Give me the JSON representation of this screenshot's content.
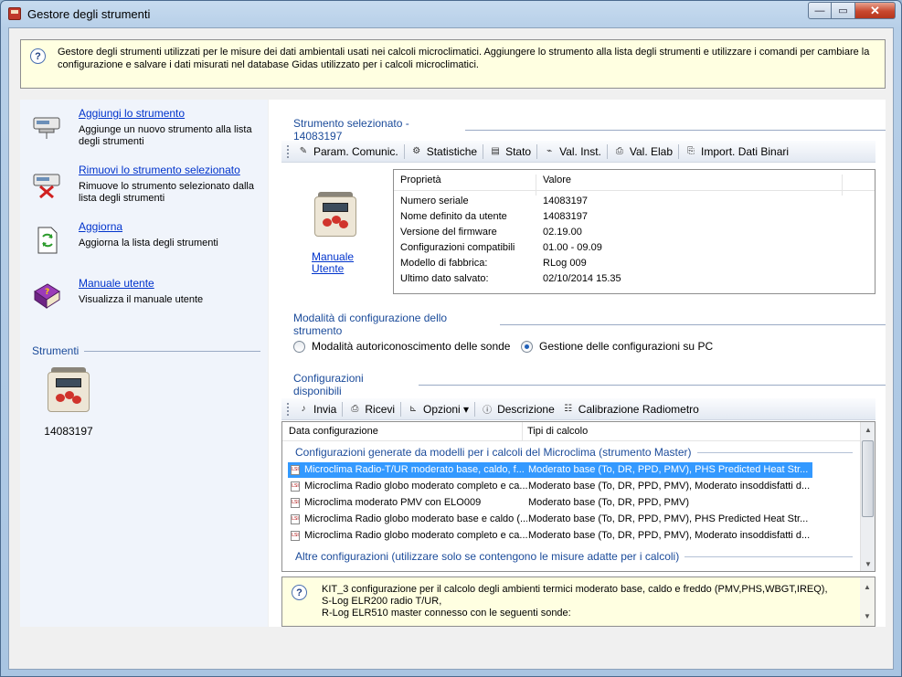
{
  "window": {
    "title": "Gestore degli strumenti",
    "minimize": "—",
    "maximize": "▭",
    "close": "✕"
  },
  "info_banner": {
    "icon": "?",
    "text": "Gestore degli strumenti utilizzati per le misure dei dati ambientali usati nei calcoli microclimatici. Aggiungere lo strumento alla lista degli strumenti e utilizzare i comandi per cambiare la configurazione e salvare i dati misurati nel database Gidas utilizzato per i calcoli microclimatici."
  },
  "sidebar": {
    "tasks": [
      {
        "label": "Aggiungi lo strumento",
        "description": "Aggiunge un nuovo strumento alla lista degli strumenti",
        "icon": "add-instrument-icon"
      },
      {
        "label": "Rimuovi lo strumento selezionato",
        "description": "Rimuove lo strumento selezionato dalla lista degli strumenti",
        "icon": "remove-instrument-icon"
      },
      {
        "label": "Aggiorna",
        "description": "Aggiorna la lista degli strumenti",
        "icon": "refresh-icon"
      },
      {
        "label": "Manuale utente",
        "description": "Visualizza il manuale utente",
        "icon": "manual-book-icon"
      }
    ],
    "instruments_header": "Strumenti",
    "instruments": [
      {
        "label": "14083197"
      }
    ]
  },
  "main": {
    "selected_header": "Strumento selezionato  - 14083197",
    "toolbar1": [
      {
        "label": "Param. Comunic.",
        "icon": "wrench-icon"
      },
      {
        "label": "Statistiche",
        "icon": "statistics-icon"
      },
      {
        "label": "Stato",
        "icon": "status-icon"
      },
      {
        "label": "Val. Inst.",
        "icon": "instant-values-icon"
      },
      {
        "label": "Val. Elab",
        "icon": "processed-values-icon"
      },
      {
        "label": "Import. Dati Binari",
        "icon": "import-binary-icon"
      }
    ],
    "manual_link": "Manuale Utente",
    "properties": {
      "col_property": "Proprietà",
      "col_value": "Valore",
      "rows": [
        {
          "name": "Numero seriale",
          "value": "14083197"
        },
        {
          "name": "Nome definito da utente",
          "value": "14083197"
        },
        {
          "name": "Versione del firmware",
          "value": "02.19.00"
        },
        {
          "name": "Configurazioni compatibili",
          "value": "01.00 - 09.09"
        },
        {
          "name": "Modello di fabbrica:",
          "value": "RLog 009"
        },
        {
          "name": "Ultimo dato salvato:",
          "value": "02/10/2014 15.35"
        }
      ]
    },
    "config_mode_header": "Modalità di configurazione dello strumento",
    "radio_auto": "Modalità autoriconoscimento delle sonde",
    "radio_pc": "Gestione delle configurazioni su PC",
    "configs_header": "Configurazioni disponibili",
    "toolbar2": [
      {
        "label": "Invia",
        "icon": "send-icon"
      },
      {
        "label": "Ricevi",
        "icon": "receive-icon"
      },
      {
        "label": "Opzioni ▾",
        "icon": "options-icon"
      },
      {
        "label": "Descrizione",
        "icon": "description-icon"
      },
      {
        "label": "Calibrazione Radiometro",
        "icon": "calibration-icon"
      }
    ],
    "config_list": {
      "col_date": "Data configurazione",
      "col_types": "Tipi di calcolo",
      "group1": "Configurazioni generate da modelli per i calcoli del Microclima  (strumento Master)",
      "rows": [
        {
          "name": "Microclima Radio-T/UR moderato base, caldo, f...",
          "types": "Moderato base (To, DR, PPD, PMV), PHS Predicted Heat Str...",
          "selected": true
        },
        {
          "name": "Microclima Radio globo moderato completo e ca...",
          "types": "Moderato base (To, DR, PPD, PMV), Moderato insoddisfatti d...",
          "selected": false
        },
        {
          "name": "Microclima moderato PMV con ELO009",
          "types": "Moderato base (To, DR, PPD, PMV)",
          "selected": false
        },
        {
          "name": "Microclima Radio globo moderato base e caldo (...",
          "types": "Moderato base (To, DR, PPD, PMV), PHS Predicted Heat Str...",
          "selected": false
        },
        {
          "name": "Microclima Radio globo moderato completo e ca...",
          "types": "Moderato base (To, DR, PPD, PMV), Moderato insoddisfatti d...",
          "selected": false
        }
      ],
      "group2": "Altre configurazioni (utilizzare solo se contengono le misure adatte per i calcoli)"
    },
    "description": "KIT_3 configurazione per il calcolo degli ambienti termici moderato base, caldo e freddo (PMV,PHS,WBGT,IREQ),\nS-Log ELR200 radio T/UR,\nR-Log ELR510 master connesso con le seguenti sonde:"
  }
}
